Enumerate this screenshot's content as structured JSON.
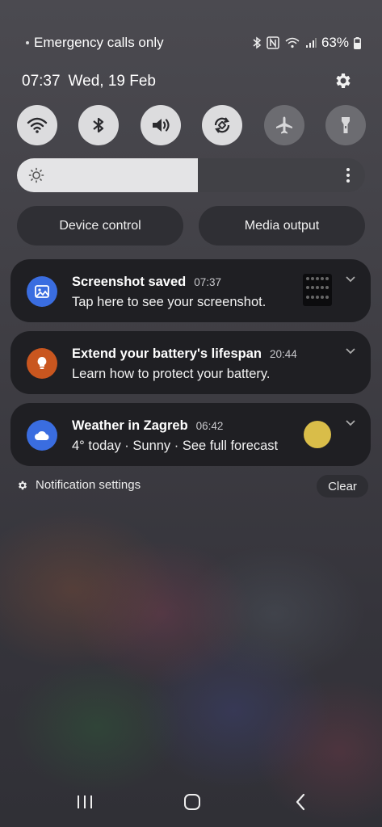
{
  "status_bar": {
    "carrier_text": "Emergency calls only",
    "battery_percent": "63%",
    "icons": [
      "bluetooth-icon",
      "nfc-icon",
      "wifi-icon",
      "signal-icon",
      "battery-icon"
    ]
  },
  "header": {
    "time": "07:37",
    "date": "Wed, 19 Feb",
    "settings_icon": "gear-icon"
  },
  "quick_settings": {
    "toggles": [
      {
        "name": "wifi",
        "icon": "wifi-icon",
        "on": true
      },
      {
        "name": "bluetooth",
        "icon": "bluetooth-icon",
        "on": true
      },
      {
        "name": "sound",
        "icon": "volume-icon",
        "on": true
      },
      {
        "name": "auto-rotate",
        "icon": "rotate-icon",
        "on": true
      },
      {
        "name": "airplane",
        "icon": "airplane-icon",
        "on": false
      },
      {
        "name": "flashlight",
        "icon": "flashlight-icon",
        "on": false
      }
    ],
    "brightness_level": 0.52
  },
  "buttons": {
    "device_control": "Device control",
    "media_output": "Media output"
  },
  "notifications": [
    {
      "title": "Screenshot saved",
      "time": "07:37",
      "body": "Tap here to see your screenshot.",
      "icon": "image-icon",
      "icon_color": "#3a6de0"
    },
    {
      "title": "Extend your battery's lifespan",
      "time": "20:44",
      "body": "Learn how to protect your battery.",
      "icon": "lightbulb-icon",
      "icon_color": "#c9561f"
    },
    {
      "title": "Weather in Zagreb",
      "time": "06:42",
      "body": "4° today · Sunny · See full forecast",
      "icon": "cloud-icon",
      "icon_color": "#3a6de0"
    }
  ],
  "footer": {
    "notification_settings": "Notification settings",
    "clear": "Clear"
  },
  "nav": [
    "recents-icon",
    "home-icon",
    "back-icon"
  ]
}
